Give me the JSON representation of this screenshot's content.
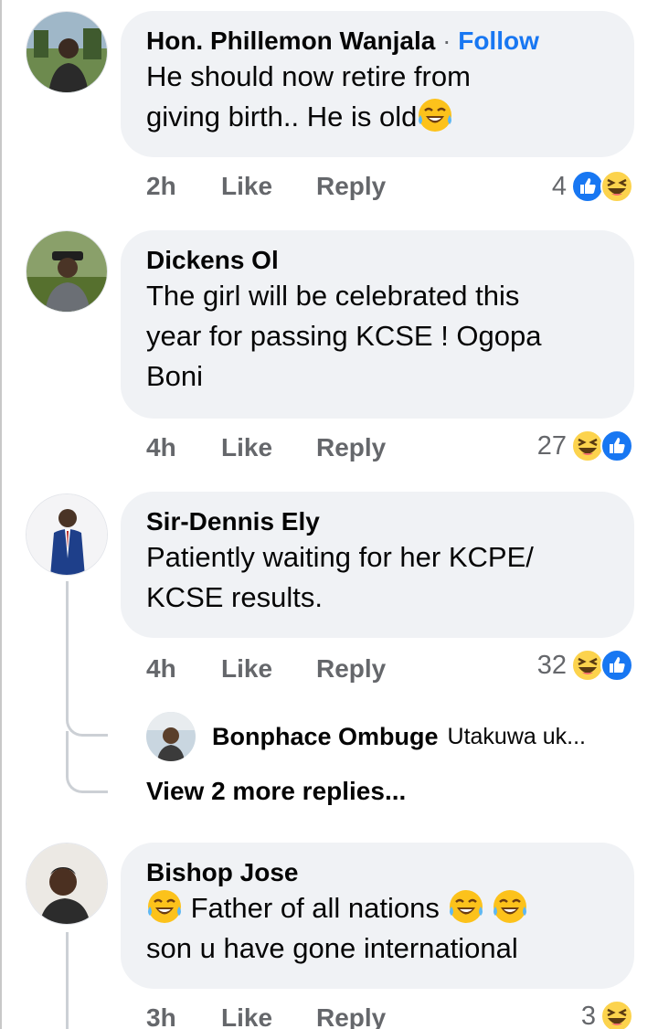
{
  "comments": [
    {
      "author": "Hon. Phillemon Wanjala",
      "separator": "·",
      "follow_label": "Follow",
      "text_line1": "He should now retire from",
      "text_line2": "giving birth..  He is old",
      "time": "2h",
      "like_label": "Like",
      "reply_label": "Reply",
      "reaction_count": "4",
      "reactions": [
        "like-icon",
        "haha-icon"
      ]
    },
    {
      "author": "Dickens Ol",
      "text_line1": "The girl will be celebrated this",
      "text_line2": "year for passing KCSE ! Ogopa",
      "text_line3": "Boni",
      "time": "4h",
      "like_label": "Like",
      "reply_label": "Reply",
      "reaction_count": "27",
      "reactions": [
        "haha-icon",
        "like-icon"
      ]
    },
    {
      "author": "Sir-Dennis Ely",
      "text_line1": "Patiently waiting for her KCPE/",
      "text_line2": "KCSE results.",
      "time": "4h",
      "like_label": "Like",
      "reply_label": "Reply",
      "reaction_count": "32",
      "reactions": [
        "haha-icon",
        "like-icon"
      ],
      "reply_preview": {
        "author": "Bonphace Ombuge",
        "snippet": "Utakuwa uk..."
      },
      "view_more_label": "View 2 more replies..."
    },
    {
      "author": "Bishop Jose",
      "text_line1": "Father of all nations",
      "text_line2": "son u have gone international",
      "time": "3h",
      "like_label": "Like",
      "reply_label": "Reply",
      "reaction_count": "3",
      "reactions": [
        "haha-icon"
      ]
    }
  ],
  "colors": {
    "bubble": "#f0f2f5",
    "link_blue": "#1877f2",
    "meta_gray": "#65676b",
    "like_blue": "#1877f2",
    "haha_yellow": "#fcd34d"
  }
}
